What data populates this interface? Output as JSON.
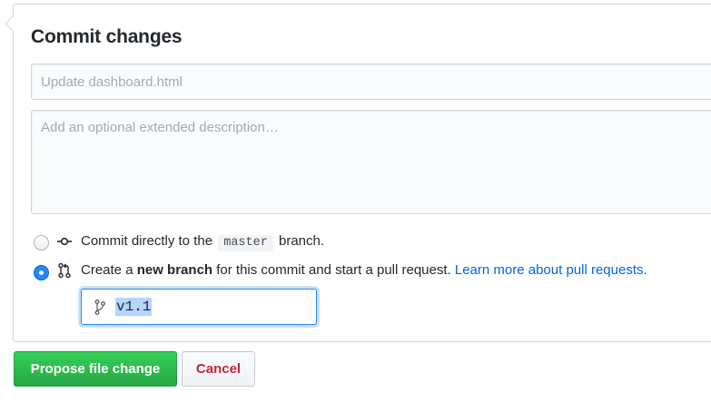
{
  "form": {
    "title": "Commit changes",
    "summary_placeholder": "Update dashboard.html",
    "description_placeholder": "Add an optional extended description…"
  },
  "options": {
    "direct": {
      "prefix": "Commit directly to the",
      "branch": "master",
      "suffix": "branch.",
      "selected": false
    },
    "new_branch": {
      "prefix": "Create a",
      "bold": "new branch",
      "middle": "for this commit and start a pull request.",
      "link": "Learn more about pull requests.",
      "selected": true
    }
  },
  "branch_input": {
    "value": "v1.1",
    "icon": "git-branch-icon"
  },
  "buttons": {
    "propose": "Propose file change",
    "cancel": "Cancel"
  },
  "colors": {
    "primary": "#28a745",
    "cancel": "#cb2431",
    "link": "#0366d6",
    "radio_selected": "#2188ff"
  }
}
